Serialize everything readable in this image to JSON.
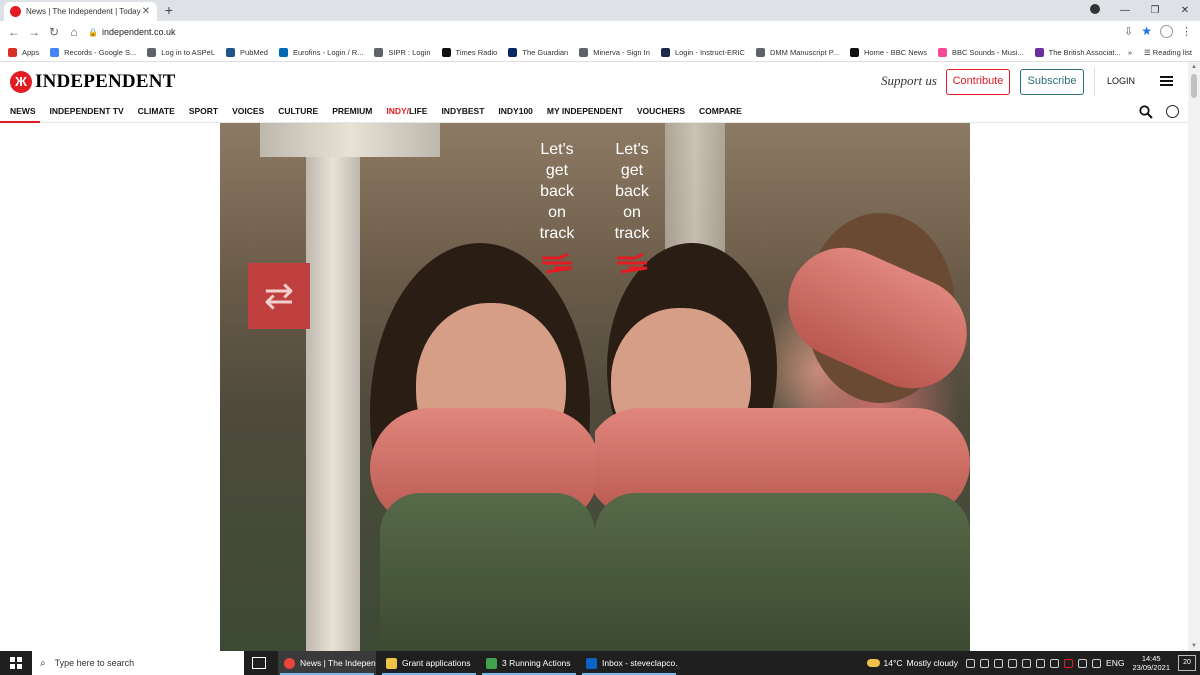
{
  "browser": {
    "tab_title": "News | The Independent | Today's",
    "url": "independent.co.uk",
    "bookmarks": [
      {
        "label": "Apps",
        "icon": "apps-grid-icon",
        "color": "#d93025"
      },
      {
        "label": "Records - Google S...",
        "icon": "google-icon",
        "color": "#4285f4"
      },
      {
        "label": "Log in to ASPeL",
        "icon": "globe-icon",
        "color": "#5f6368"
      },
      {
        "label": "PubMed",
        "icon": "pubmed-icon",
        "color": "#20558a"
      },
      {
        "label": "Eurofins - Login / R...",
        "icon": "eurofins-icon",
        "color": "#0069b4"
      },
      {
        "label": "SIPR : Login",
        "icon": "globe-icon",
        "color": "#5f6368"
      },
      {
        "label": "Times Radio",
        "icon": "times-icon",
        "color": "#111111"
      },
      {
        "label": "The Guardian",
        "icon": "guardian-icon",
        "color": "#052962"
      },
      {
        "label": "Minerva - Sign In",
        "icon": "globe-icon",
        "color": "#5f6368"
      },
      {
        "label": "Login - Instruct-ERIC",
        "icon": "instruct-icon",
        "color": "#1e2a4a"
      },
      {
        "label": "DMM Manuscript P...",
        "icon": "globe-icon",
        "color": "#5f6368"
      },
      {
        "label": "Home - BBC News",
        "icon": "bbc-icon",
        "color": "#111111"
      },
      {
        "label": "BBC Sounds - Musi...",
        "icon": "sounds-icon",
        "color": "#f54997"
      },
      {
        "label": "The British Associat...",
        "icon": "association-icon",
        "color": "#6b2fa0"
      }
    ],
    "more_bookmarks": "»",
    "reading_list": "Reading list"
  },
  "site": {
    "logo_text": "INDEPENDENT",
    "support_text": "Support us",
    "contribute_label": "Contribute",
    "subscribe_label": "Subscribe",
    "login_label": "LOGIN",
    "nav": [
      {
        "label": "NEWS",
        "active": true
      },
      {
        "label": "INDEPENDENT TV"
      },
      {
        "label": "CLIMATE"
      },
      {
        "label": "SPORT"
      },
      {
        "label": "VOICES"
      },
      {
        "label": "CULTURE"
      },
      {
        "label": "PREMIUM"
      },
      {
        "label_a": "INDY/",
        "label_b": "LIFE"
      },
      {
        "label": "INDYBEST"
      },
      {
        "label": "INDY100"
      },
      {
        "label": "MY INDEPENDENT"
      },
      {
        "label": "VOUCHERS"
      },
      {
        "label": "COMPARE"
      }
    ]
  },
  "advert": {
    "line1": "Let's",
    "line2": "get",
    "line3": "back",
    "line4": "on",
    "line5": "track",
    "logo_icon": "national-rail-icon",
    "logo_color": "#e31c23"
  },
  "taskbar": {
    "search_placeholder": "Type here to search",
    "apps": [
      {
        "label": "News | The Indepen...",
        "icon": "chrome-icon",
        "color": "#e8453c"
      },
      {
        "label": "Grant applications",
        "icon": "folder-icon",
        "color": "#f0c24a"
      },
      {
        "label": "3 Running Actions",
        "icon": "actions-icon",
        "color": "#3fa34d"
      },
      {
        "label": "Inbox - steveclapco...",
        "icon": "outlook-icon",
        "color": "#0a64c8"
      }
    ],
    "weather_temp": "14°C",
    "weather_desc": "Mostly cloudy",
    "language": "ENG",
    "time": "14:45",
    "date": "23/09/2021",
    "notifications": "20"
  }
}
